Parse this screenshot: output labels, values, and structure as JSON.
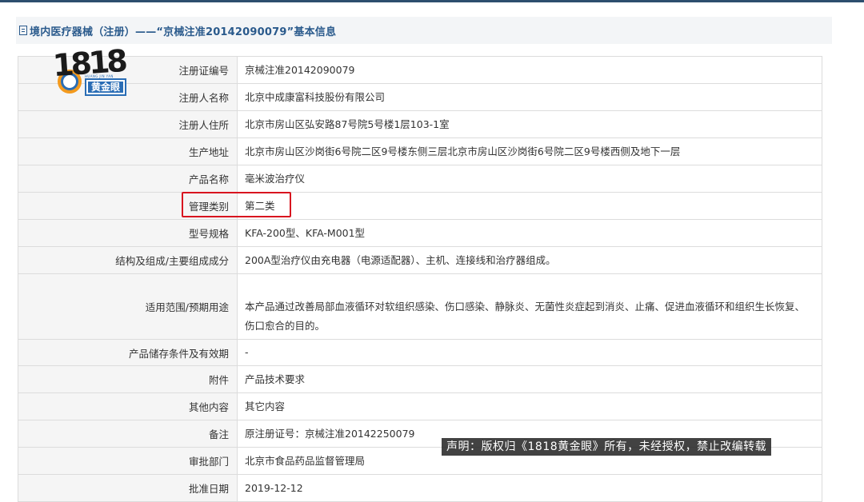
{
  "header": {
    "title": "境内医疗器械（注册）——“京械注准20142090079”基本信息"
  },
  "logo": {
    "number": "1818",
    "badge": "黄金眼",
    "subtext": "HUANG JIN YAN"
  },
  "rows": [
    {
      "label": "注册证编号",
      "value": "京械注准20142090079"
    },
    {
      "label": "注册人名称",
      "value": "北京中成康富科技股份有限公司"
    },
    {
      "label": "注册人住所",
      "value": "北京市房山区弘安路87号院5号楼1层103-1室"
    },
    {
      "label": "生产地址",
      "value": "北京市房山区沙岗街6号院二区9号楼东侧三层北京市房山区沙岗街6号院二区9号楼西侧及地下一层"
    },
    {
      "label": "产品名称",
      "value": "毫米波治疗仪"
    },
    {
      "label": "管理类别",
      "value": "第二类"
    },
    {
      "label": "型号规格",
      "value": "KFA-200型、KFA-M001型"
    },
    {
      "label": "结构及组成/主要组成成分",
      "value": "200A型治疗仪由充电器（电源适配器）、主机、连接线和治疗器组成。"
    },
    {
      "label": "适用范围/预期用途",
      "value": "本产品通过改善局部血液循环对软组织感染、伤口感染、静脉炎、无菌性炎症起到消炎、止痛、促进血液循环和组织生长恢复、伤口愈合的目的。"
    },
    {
      "label": "产品储存条件及有效期",
      "value": "-"
    },
    {
      "label": "附件",
      "value": "产品技术要求"
    },
    {
      "label": "其他内容",
      "value": "其它内容"
    },
    {
      "label": "备注",
      "value": "原注册证号：京械注准20142250079"
    },
    {
      "label": "审批部门",
      "value": "北京市食品药品监督管理局"
    },
    {
      "label": "批准日期",
      "value": "2019-12-12"
    }
  ],
  "watermark": "声明：版权归《1818黄金眼》所有，未经授权，禁止改编转载",
  "colors": {
    "title": "#2a5a8c",
    "highlight": "#d8141f",
    "label_bg": "#f5f5f5"
  }
}
